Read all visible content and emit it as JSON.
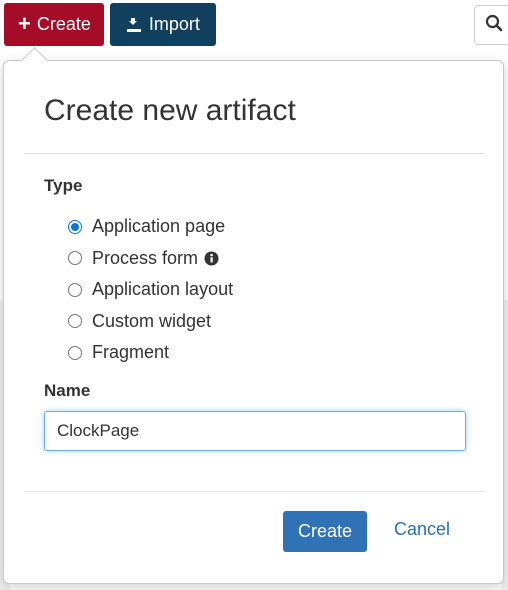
{
  "toolbar": {
    "create_label": "Create",
    "import_label": "Import"
  },
  "colors": {
    "create_bg": "#a40c28",
    "import_bg": "#11405e",
    "primary": "#2f73b6",
    "radio_accent": "#0b75d6"
  },
  "icons": {
    "create": "plus-icon",
    "import": "import-icon",
    "search": "search-icon",
    "info": "info-icon"
  },
  "dialog": {
    "title": "Create new artifact",
    "type_label": "Type",
    "types": [
      {
        "label": "Application page",
        "checked": true
      },
      {
        "label": "Process form",
        "checked": false
      },
      {
        "label": "Application layout",
        "checked": false
      },
      {
        "label": "Custom widget",
        "checked": false
      },
      {
        "label": "Fragment",
        "checked": false
      }
    ],
    "name_label": "Name",
    "name_value": "ClockPage",
    "create_button": "Create",
    "cancel_button": "Cancel"
  }
}
